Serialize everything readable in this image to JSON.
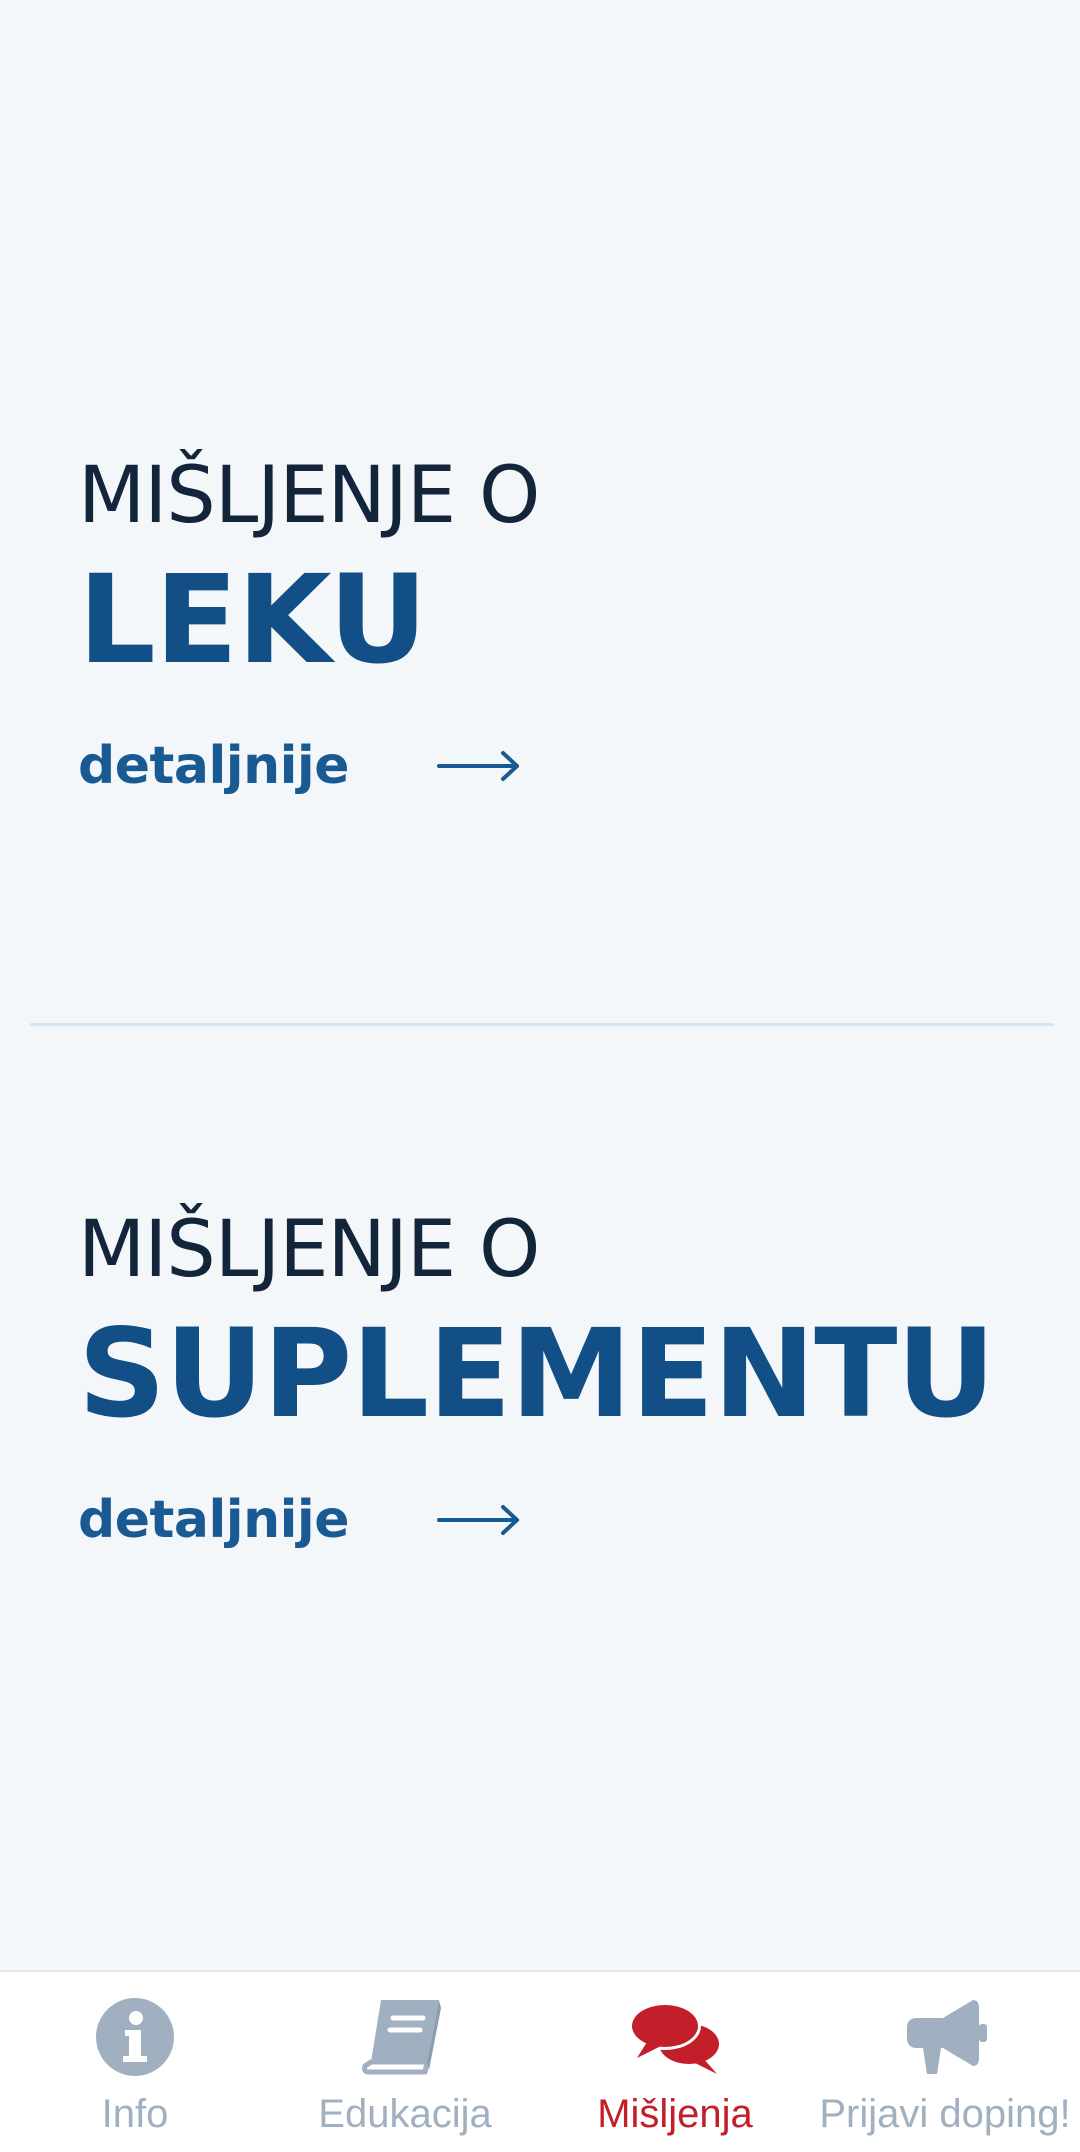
{
  "sections": [
    {
      "eyebrow": "MIŠLJENJE O",
      "headline": "LEKU",
      "link_label": "detaljnije",
      "link_icon": "arrow-right-icon"
    },
    {
      "eyebrow": "MIŠLJENJE O",
      "headline": "SUPLEMENTU",
      "link_label": "detaljnije",
      "link_icon": "arrow-right-icon"
    }
  ],
  "tabs": [
    {
      "label": "Info",
      "icon": "info-icon",
      "active": false
    },
    {
      "label": "Edukacija",
      "icon": "book-icon",
      "active": false
    },
    {
      "label": "Mišljenja",
      "icon": "chat-bubbles-icon",
      "active": true
    },
    {
      "label": "Prijavi doping!",
      "icon": "megaphone-icon",
      "active": false
    }
  ],
  "colors": {
    "background": "#f4f7f9",
    "eyebrow_text": "#13253b",
    "headline_text": "#124f86",
    "link_text": "#1a5a92",
    "divider": "#d2e6f5",
    "tab_inactive": "#a0b0c0",
    "tab_active": "#c21f2a"
  }
}
